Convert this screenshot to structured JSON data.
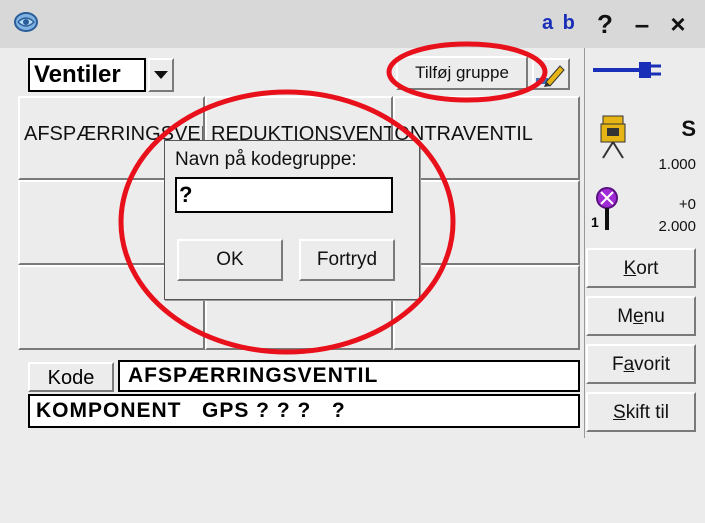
{
  "titlebar": {
    "ab_label": "a b",
    "help": "?",
    "minimize": "–",
    "close": "×"
  },
  "toolbar": {
    "dropdown_value": "Ventiler",
    "add_group_label": "Tilføj gruppe"
  },
  "grid": {
    "cells": [
      "AFSPÆRRINGSVENTIL",
      "REDUKTIONSVENTIL",
      "KONTRAVENTIL",
      "",
      "",
      "",
      "",
      "",
      "",
      "",
      "",
      ""
    ]
  },
  "status": {
    "mode": "S",
    "value1": "1.000",
    "offset": "+0",
    "value2": "2.000",
    "count": "1"
  },
  "side_buttons": [
    {
      "pre": "",
      "ul": "K",
      "post": "ort"
    },
    {
      "pre": "M",
      "ul": "e",
      "post": "nu"
    },
    {
      "pre": "F",
      "ul": "a",
      "post": "vorit"
    },
    {
      "pre": "",
      "ul": "S",
      "post": "kift til"
    }
  ],
  "code": {
    "label": "Kode",
    "value": "AFSPÆRRINGSVENTIL",
    "component_line": "KOMPONENT   GPS ? ? ?   ?"
  },
  "dialog": {
    "label": "Navn på kodegruppe:",
    "input_value": "?",
    "ok_label": "OK",
    "cancel_label": "Fortryd"
  },
  "colors": {
    "annotation_red": "#e8101a",
    "ab_blue": "#1a2fb8",
    "connection_blue": "#1a2fb8"
  }
}
